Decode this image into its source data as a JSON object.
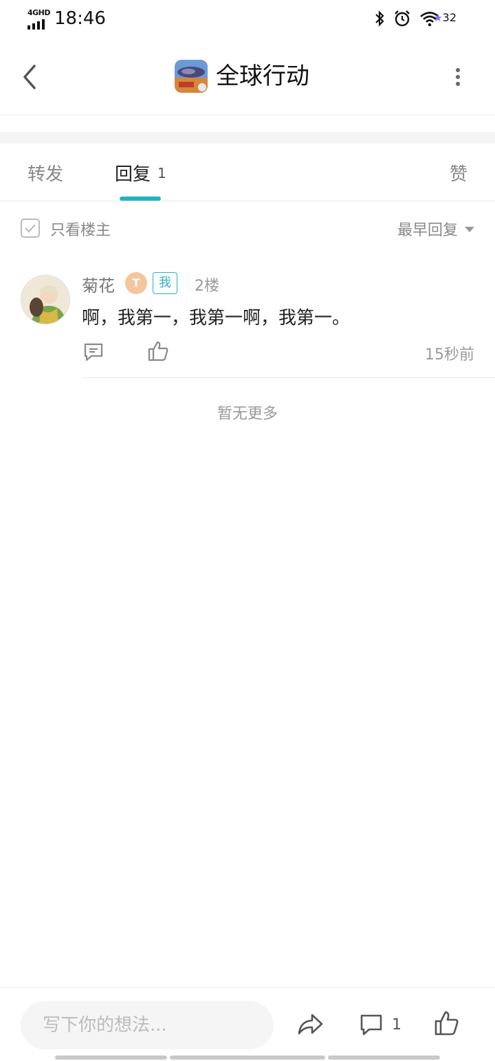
{
  "status_bar": {
    "network": "4GHD",
    "time": "18:46",
    "battery": "32",
    "icons": [
      "bluetooth-icon",
      "alarm-icon",
      "wifi-icon"
    ]
  },
  "header": {
    "title": "全球行动",
    "icons": [
      "back-arrow-icon",
      "game-logo-icon",
      "more-vertical-icon"
    ]
  },
  "tabs": {
    "forward_label": "转发",
    "reply_label": "回复",
    "reply_count": "1",
    "like_label": "赞",
    "active_color": "#1bb5c4"
  },
  "filter": {
    "only_op_label": "只看楼主",
    "sort_label": "最早回复"
  },
  "comments": [
    {
      "user": "菊花",
      "level_badge": "T",
      "me_badge": "我",
      "floor": "2楼",
      "text": "啊，我第一，我第一啊，我第一。",
      "time": "15秒前"
    }
  ],
  "no_more": "暂无更多",
  "bottom_bar": {
    "input_placeholder": "写下你的想法...",
    "reply_count": "1",
    "icons": [
      "share-icon",
      "comment-icon",
      "like-icon"
    ]
  },
  "colors": {
    "accent": "#1bb5c4",
    "level_badge": "#f5c69b"
  }
}
